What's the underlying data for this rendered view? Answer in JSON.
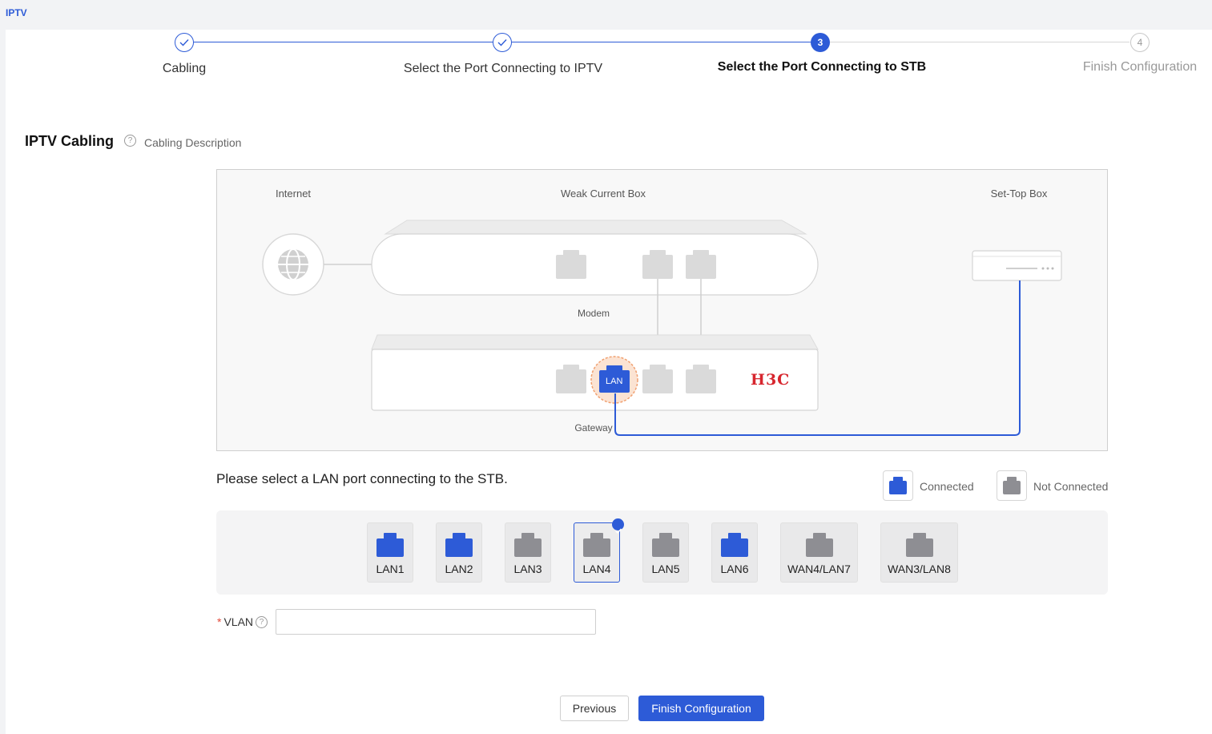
{
  "page": {
    "tab_title": "IPTV"
  },
  "stepper": {
    "steps": [
      {
        "number": "1",
        "label": "Cabling",
        "state": "done"
      },
      {
        "number": "2",
        "label": "Select the Port Connecting to IPTV",
        "state": "done"
      },
      {
        "number": "3",
        "label": "Select the Port Connecting to STB",
        "state": "active"
      },
      {
        "number": "4",
        "label": "Finish Configuration",
        "state": "todo"
      }
    ]
  },
  "cabling": {
    "title": "IPTV Cabling",
    "description_link": "Cabling Description"
  },
  "diagram": {
    "internet_label": "Internet",
    "weak_box_label": "Weak Current Box",
    "stb_label": "Set-Top Box",
    "modem_label": "Modem",
    "gateway_label": "Gateway",
    "lan_badge": "LAN",
    "brand_logo_text": "H3C"
  },
  "selection": {
    "prompt": "Please select a LAN port connecting to the STB.",
    "legend_connected": "Connected",
    "legend_not_connected": "Not Connected",
    "colors": {
      "connected": "#2d5bd7",
      "not_connected": "#8e8e93",
      "accent": "#2d5bd7"
    },
    "ports": [
      {
        "label": "LAN1",
        "connected": true,
        "selected": false
      },
      {
        "label": "LAN2",
        "connected": true,
        "selected": false
      },
      {
        "label": "LAN3",
        "connected": false,
        "selected": false
      },
      {
        "label": "LAN4",
        "connected": false,
        "selected": true
      },
      {
        "label": "LAN5",
        "connected": false,
        "selected": false
      },
      {
        "label": "LAN6",
        "connected": true,
        "selected": false
      },
      {
        "label": "WAN4/LAN7",
        "connected": false,
        "selected": false
      },
      {
        "label": "WAN3/LAN8",
        "connected": false,
        "selected": false
      }
    ]
  },
  "vlan": {
    "required_mark": "*",
    "label": "VLAN",
    "value": ""
  },
  "buttons": {
    "previous": "Previous",
    "finish": "Finish Configuration"
  }
}
